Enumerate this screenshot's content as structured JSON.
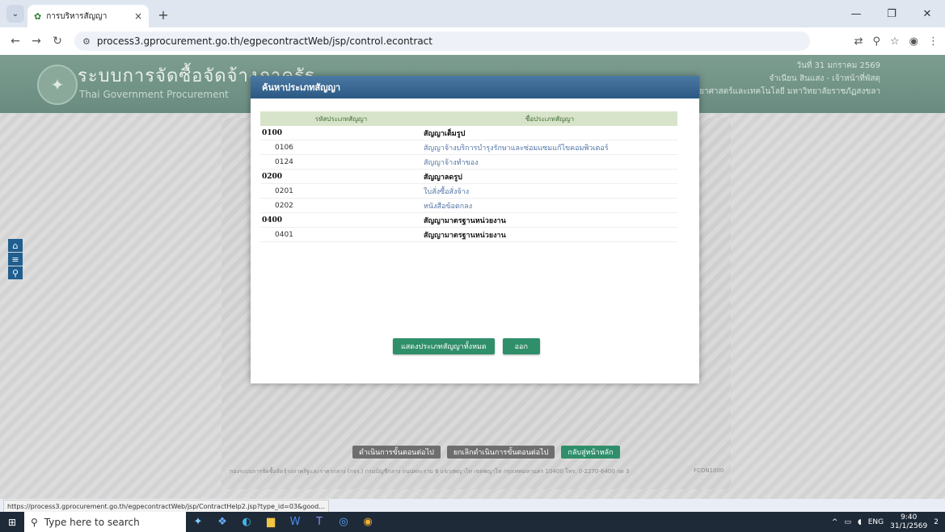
{
  "browser": {
    "tab_title": "การบริหารสัญญา",
    "new_tab": "+",
    "url": "process3.gprocurement.go.th/egpecontractWeb/jsp/control.econtract",
    "status_url": "https://process3.gprocurement.go.th/egpecontractWeb/jsp/ContractHelp2.jsp?type_id=03&good..."
  },
  "header": {
    "title": "ระบบการจัดซื้อจัดจ้างภาครัฐ",
    "subtitle": "Thai Government Procurement",
    "date": "วันที่ 31 มกราคม 2569",
    "user": "จำเนียน สินแสง - เจ้าหน้าที่พัสดุ",
    "department": "คณะวิทยาศาสตร์และเทคโนโลยี มหาวิทยาลัยราชภัฏสงขลา"
  },
  "modal": {
    "title": "ค้นหาประเภทสัญญา",
    "columns": [
      "รหัสประเภทสัญญา",
      "ชื่อประเภทสัญญา"
    ],
    "rows": [
      {
        "code": "0100",
        "name": "สัญญาเต็มรูป"
      },
      {
        "code": "0106",
        "name": "สัญญาจ้างบริการบำรุงรักษาและซ่อมแซมแก้ไขคอมพิวเตอร์"
      },
      {
        "code": "0124",
        "name": "สัญญาจ้างทำของ"
      },
      {
        "code": "0200",
        "name": "สัญญาลดรูป"
      },
      {
        "code": "0201",
        "name": "ใบสั่งซื้อสั่งจ้าง"
      },
      {
        "code": "0202",
        "name": "หนังสือข้อตกลง"
      },
      {
        "code": "0400",
        "name": "สัญญามาตรฐานหน่วยงาน"
      },
      {
        "code": "0401",
        "name": "สัญญามาตรฐานหน่วยงาน"
      }
    ],
    "show_all_button": "แสดงประเภทสัญญาทั้งหมด",
    "close_button": "ออก"
  },
  "page_buttons": {
    "next_step": "ดำเนินการขั้นตอนต่อไป",
    "cancel_next": "ยกเลิกดำเนินการขั้นตอนต่อไป",
    "home": "กลับสู่หน้าหลัก"
  },
  "footer": {
    "text": "กองระบบการจัดซื้อจัดจ้างภาครัฐและราคากลาง (กจร.) กรมบัญชีกลาง ถนนพระราม 6 แขวงพญาไท เขตพญาไท กรุงเทพมหานคร 10400 โทร. 0-2270-6400 กด 3",
    "code": "FCON1000"
  },
  "taskbar": {
    "search_placeholder": "Type here to search",
    "lang": "ENG",
    "time": "9:40",
    "date": "31/1/2569",
    "notification_count": "2"
  },
  "icons": {
    "home": "home-icon",
    "menu": "menu-icon",
    "search": "search-icon"
  }
}
